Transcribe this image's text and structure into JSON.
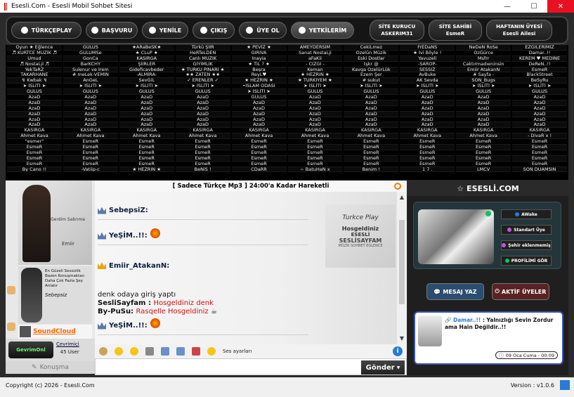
{
  "window": {
    "title": "Esesli.Com - Esesli Mobil Sohbet Sitesi"
  },
  "nav": {
    "buttons": [
      "TÜRKÇEPLAY",
      "BAŞVURU",
      "YENİLE",
      "ÇIKIŞ",
      "ÜYE OL",
      "YETKİLERİM"
    ],
    "info": [
      {
        "title": "SİTE KURUCU",
        "value": "ASKERIM31"
      },
      {
        "title": "SİTE SAHİBİ",
        "value": "EsmeR"
      },
      {
        "title": "HAFTANIN ÜYESİ",
        "value": "Esesli Ailesi"
      }
    ]
  },
  "grid": {
    "columns": [
      [
        "Oyun ★ Eğlence",
        "♬ KURTCE MÜZİK ♬",
        "Umud",
        "♬ NostaLjİ ♬",
        "YekTaRZ",
        "TAKARHANE",
        "↯ Kwbak ↯",
        "➤ İSLİTİ ➤",
        "GÜLÜS",
        "AzaD",
        "AzaD",
        "AzaD",
        "AzaD",
        "AzaD",
        "AzaD",
        "KASIRGA",
        "Ahmet Kava",
        "\"esmer\"",
        "EsmeR",
        "EsmeR",
        "EsmeR",
        "EsmeR",
        "By Cano !!"
      ],
      [
        "GÜLÜS",
        "GÜLÜMSe",
        "GonCa",
        "BarKCHY",
        "Sulenur ve İrem",
        "# meLek-VEMİN",
        "AnGeL",
        "➤ İSLİTİ ➤",
        "GÜLÜS",
        "AzaD",
        "AzaD",
        "AzaD",
        "AzaD",
        "AzaD",
        "AzaD",
        "KASIRGA",
        "Ahmet Kava",
        "EsmeR",
        "EsmeR",
        "EsmeR",
        "EsmeR",
        "EsmeR",
        "-Vatiip-c"
      ],
      [
        "★ARaBeSK★",
        "★ CLuP ★",
        "KASIRGA",
        "ŞİİRLER",
        "Gideficavbeder",
        "-ALMİRA-",
        "SevGiL",
        "➤ İSLİTİ ➤",
        "GÜLÜS",
        "AzaD",
        "AzaD",
        "AzaD",
        "AzaD",
        "AzaD",
        "AzaD",
        "KASIRGA",
        "Ahmet Kava",
        "EsmeR",
        "EsmeR",
        "EsmeR",
        "EsmeR",
        "EsmeR",
        "★ HEZRIN ★"
      ],
      [
        "Türkü ŞİİR",
        "HeRTeLDEN",
        "Canlı MÜZİK",
        "GİYİMLİK",
        "★ TÜRKÜ PİNARI ★",
        "★★ ZATEN ★★",
        "✓ ERENLER ✓",
        "➤ İSLİTİ ➤",
        "GÜLÜS",
        "AzaD",
        "AzaD",
        "AzaD",
        "AzaD",
        "AzaD",
        "AzaD",
        "KASIRGA",
        "Ahmet Kava",
        "EsmeR",
        "EsmeR",
        "EsmeR",
        "EsmeR",
        "EsmeR",
        "BeNiS !"
      ],
      [
        "★ PEVİZ ★",
        "GIRIVA",
        "İnayia",
        "★ TiL ? ★",
        "Beşra",
        "ReyL♥",
        "★ HEZRIN ★",
        "•İSLAM ODASI",
        "➤ İSLİTİ ➤",
        "GÜLÜS",
        "AzaD",
        "AzaD",
        "AzaD",
        "AzaD",
        "AzaD",
        "KASIRGA",
        "Ahmet Kava",
        "EsmeR",
        "EsmeR",
        "EsmeR",
        "EsmeR",
        "EsmeR",
        "CDaRR"
      ],
      [
        "AMEYDERSİM",
        "Sanat NostaLji",
        "aFaKii",
        "- CİZGİ -",
        "Keman",
        "★ HEZRIN ★",
        "★ TÜRKİYEM ★",
        "➤ İSLİTİ ➤",
        "GÜLÜS",
        "AzaD",
        "AzaD",
        "AzaD",
        "AzaD",
        "AzaD",
        "AzaD",
        "KASIRGA",
        "Ahmet Kava",
        "EsmeR",
        "EsmeR",
        "EsmeR",
        "EsmeR",
        "EsmeR",
        "~ BatuHaN x"
      ],
      [
        "CekiLmez",
        "Özelün Müzik",
        "Eski Dostlar",
        "tşkr  @",
        "Kavga ÖzelürLük",
        "Ezem Şer",
        "# sukut",
        "➤ İSLİTİ ➤",
        "GÜLÜS",
        "AzaD",
        "AzaD",
        "AzaD",
        "AzaD",
        "AzaD",
        "AzaD",
        "KASIRGA",
        "Ahmet Kava",
        "EsmeR",
        "EsmeR",
        "EsmeR",
        "EsmeR",
        "EsmeR",
        "Benim !"
      ],
      [
        "FrEDaNS",
        "★ İvi Böyle !",
        "Yavuzeli",
        "-SAROP-",
        "SESSİZ",
        "AvBuke",
        "AK Sevda",
        "➤ İSLİTİ ➤",
        "GÜLÜS",
        "AzaD",
        "AzaD",
        "AzaD",
        "AzaD",
        "AzaD",
        "AzaD",
        "KASIRGA",
        "Ahmet Kava",
        "EsmeR",
        "EsmeR",
        "EsmeR",
        "EsmeR",
        "EsmeR",
        "1 7 ."
      ],
      [
        "NeDeN RoSe",
        "ÖzGürce",
        "Msfrr",
        "Caktırmadıeninsin",
        "Emiir AtakanN",
        "# Sayfa -",
        "SON_Bugs",
        "➤ İSLİTİ ➤",
        "GÜLÜS",
        "AzaD",
        "AzaD",
        "AzaD",
        "AzaD",
        "AzaD",
        "AzaD",
        "KASIRGA",
        "Ahmet Kava",
        "EsmeR",
        "EsmeR",
        "EsmeR",
        "EsmeR",
        "EsmeR",
        "LMCV"
      ],
      [
        "EZGİLERİMİZ",
        "Damar..!!",
        "KEREM ♥ MEDİNE",
        "DeReN..!!",
        "EsmeR",
        "BlackStreet",
        "BeSyRu",
        "➤ İSLİTİ ➤",
        "GÜLÜS",
        "AzaD",
        "AzaD",
        "AzaD",
        "AzaD",
        "AzaD",
        "AzaD",
        "KASIRGA",
        "- DivaR x !",
        "EsmeR",
        "EsmeR",
        "EsmeR",
        "EsmeR",
        "EsmeR",
        "SON DUAMSIN"
      ]
    ]
  },
  "left": {
    "img1_text": "Gerdim Sabrıma",
    "img1_brand": "Emiir",
    "img2_text": "En Güzeli Sessizlik Bazen Konuşmaktan Daha Çok Fazla Şey Anlatır",
    "img2_brand": "Sebepsiz",
    "soundcloud": "SoundCloud",
    "badge": "GevrimOnl",
    "online_link": "Çevrimiçi",
    "online_count": "45 User",
    "konusma": "Konuşma"
  },
  "chat": {
    "header": "[ Sadece Türkçe Mp3 ] 24:00'a Kadar Hareketli",
    "messages": [
      "SebepsiZ:",
      "YeŞİM..!!:",
      "Emiir_AtakanN:",
      "YeŞİM..!!:"
    ],
    "system_line1": "denk odaya giriş yaptı",
    "system_line2_user": "SesliSayfam :",
    "system_line2_text": "Hosgeldiniz denk",
    "system_line3_user": "By-PuSu:",
    "system_line3_text": "Rasqelle Hosgeldiniz",
    "banner": {
      "l1": "Turkce Play",
      "l2": "Hosgeldiniz",
      "l3": "ESESLİ",
      "l4": "SESLİSAYFAM",
      "l5": "MÜZİK SOHBET EĞLENCE"
    }
  },
  "toolbar": {
    "sound_label": "Ses ayarları",
    "info": "i"
  },
  "send": {
    "label": "Gönder"
  },
  "right": {
    "brand": "ESESLİ.COM",
    "status": "AWake",
    "role": "Standart Üye",
    "city": "Şehir eklenmemiş",
    "profile_link": "PROFİLİMİ GÖR",
    "btn_message": "MESAJ YAZ",
    "btn_active": "AKTİF ÜYELER",
    "post_user": "Damar..!!",
    "post_text": ": Yalnızlığı Sevin Zordur ama Hain Değildir..!!",
    "post_time": "09 Oca Cuma - 00:09"
  },
  "status": {
    "copyright": "Copyright (c) 2026 - Esesli.Com",
    "version": "Version : v1.0.6"
  },
  "colors": {
    "accent": "#2b7ad6",
    "red": "#d01010",
    "online": "#16c05c",
    "bg_dark": "#1f1f1f"
  }
}
